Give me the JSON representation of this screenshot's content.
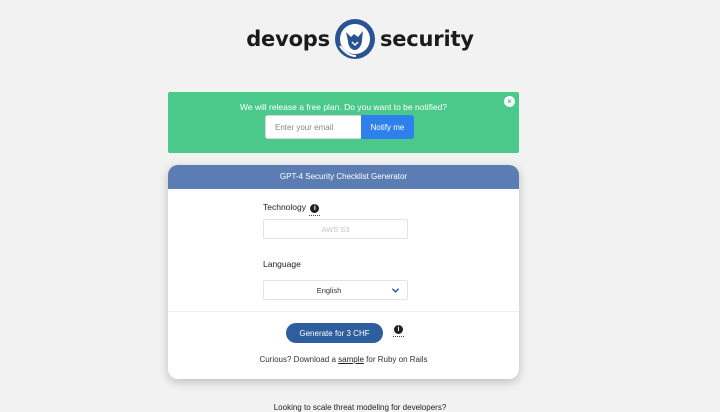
{
  "logo": {
    "left": "devops",
    "right": "security"
  },
  "banner": {
    "message": "We will release a free plan. Do you want to be notified?",
    "close": "×",
    "email_placeholder": "Enter your email",
    "notify_label": "Notify me",
    "background": "#4bc98a"
  },
  "card": {
    "title": "GPT-4 Security Checklist Generator",
    "technology_label": "Technology",
    "technology_placeholder": "AWS S3",
    "language_label": "Language",
    "language_value": "English",
    "info_glyph": "i",
    "generate_label": "Generate for 3 CHF",
    "sample_prefix": "Curious? Download a ",
    "sample_link": "sample",
    "sample_suffix": " for Ruby on Rails",
    "header_color": "#5b7db3",
    "button_color": "#2d5f9e"
  },
  "footer": {
    "text": "Looking to scale threat modeling for developers?"
  },
  "icons": {
    "logo": "fox-shield-icon",
    "close": "close-icon",
    "info": "info-icon",
    "chevron": "chevron-down-icon"
  }
}
